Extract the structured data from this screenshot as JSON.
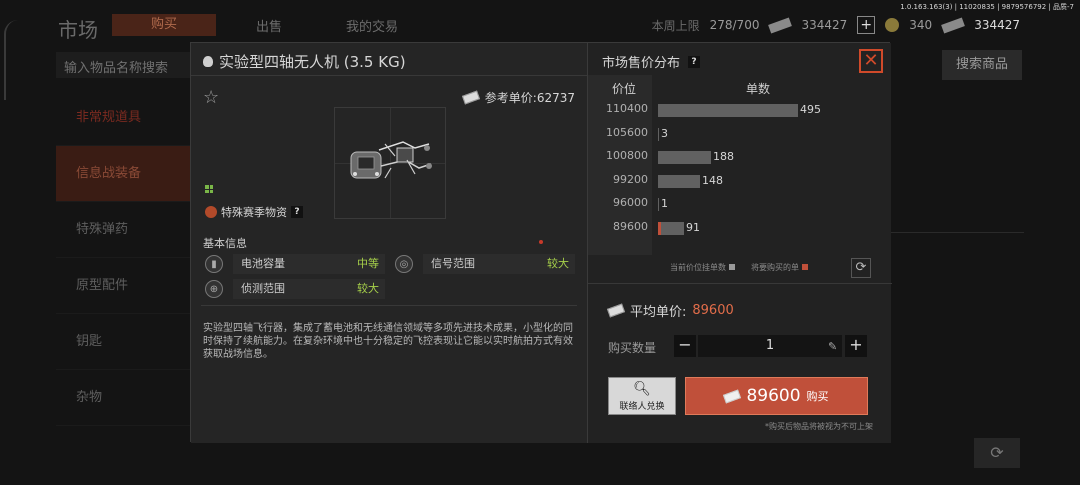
{
  "background": {
    "page_title": "市场",
    "tabs": [
      "购买",
      "出售",
      "我的交易"
    ],
    "weekly_limit_label": "本周上限",
    "weekly_limit_value": "278/700",
    "currency1_value": "334427",
    "coin_value": "340",
    "currency2_value": "334427",
    "version_text": "1.0.163.163(3) | 11020835 | 9879576792 | 品质-7",
    "search_placeholder": "输入物品名称搜索",
    "search_button": "搜索商品",
    "sidebar": [
      "非常规道具",
      "信息战装备",
      "特殊弹药",
      "原型配件",
      "钥匙",
      "杂物"
    ]
  },
  "item": {
    "title": "实验型四轴无人机 (3.5 KG)",
    "ref_price_label": "参考单价:",
    "ref_price_value": "62737",
    "season_tag": "特殊赛季物资",
    "basic_info_label": "基本信息",
    "stats": [
      {
        "name": "电池容量",
        "level": "中等",
        "icon": "battery-icon"
      },
      {
        "name": "信号范围",
        "level": "较大",
        "icon": "signal-icon"
      },
      {
        "name": "侦测范围",
        "level": "较大",
        "icon": "radar-icon"
      }
    ],
    "description": "实验型四轴飞行器，集成了蓄电池和无线通信领域等多项先进技术成果，小型化的同时保持了续航能力。在复杂环境中也十分稳定的飞控表现让它能以实时航拍方式有效获取战场信息。"
  },
  "market": {
    "title": "市场售价分布",
    "col_price": "价位",
    "col_qty": "单数",
    "legend_current": "当前价位挂单数",
    "legend_buy": "将要购买的单",
    "avg_label": "平均单价:",
    "avg_value": "89600",
    "qty_label": "购买数量",
    "qty_value": "1",
    "exchange_label": "联络人兑换",
    "buy_price": "89600",
    "buy_label": "购买",
    "footnote": "*购买后物品将被视为不可上架"
  },
  "chart_data": {
    "type": "bar",
    "orientation": "horizontal",
    "xlabel": "单数",
    "ylabel": "价位",
    "categories": [
      "110400",
      "105600",
      "100800",
      "99200",
      "96000",
      "89600"
    ],
    "values": [
      495,
      3,
      188,
      148,
      1,
      91
    ],
    "highlight_index": 5,
    "colors": {
      "bar": "#616161",
      "highlight": "#c0503a"
    }
  }
}
